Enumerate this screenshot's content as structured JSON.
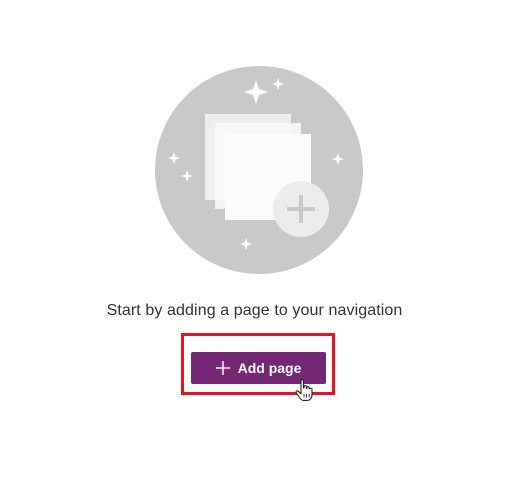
{
  "empty_state": {
    "illustration_icon": "stacked-pages-add-icon",
    "message": "Start by adding a page to your navigation",
    "add_page_button": {
      "label": "Add page",
      "icon": "plus-icon",
      "color": "#742774"
    }
  },
  "highlight_color": "#e81123",
  "cursor_icon": "hand-pointer-icon"
}
